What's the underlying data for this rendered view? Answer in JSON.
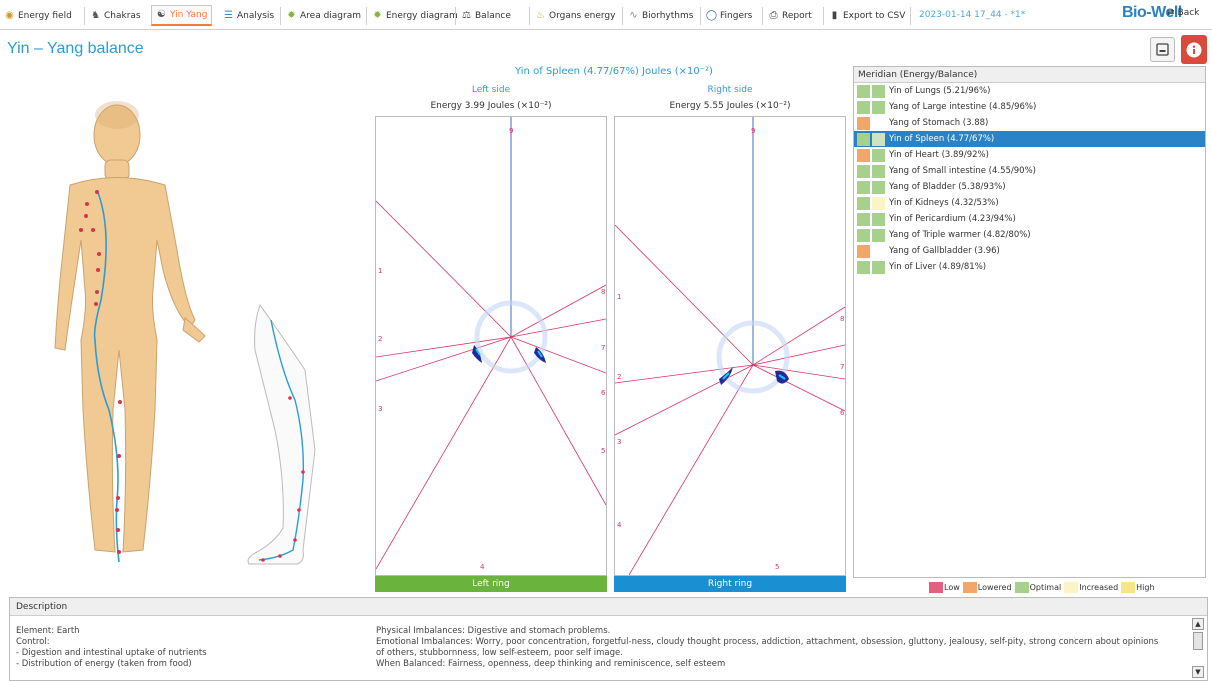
{
  "toolbar": {
    "tabs": [
      {
        "label": "Energy field",
        "icon": "energy-field-icon"
      },
      {
        "label": "Chakras",
        "icon": "chakras-icon"
      },
      {
        "label": "Yin Yang",
        "icon": "yin-yang-icon",
        "active": true
      },
      {
        "label": "Analysis",
        "icon": "analysis-icon"
      },
      {
        "label": "Area diagram",
        "icon": "area-diagram-icon"
      },
      {
        "label": "Energy diagram",
        "icon": "energy-diagram-icon"
      },
      {
        "label": "Balance",
        "icon": "balance-icon"
      },
      {
        "label": "Organs energy",
        "icon": "organs-energy-icon"
      },
      {
        "label": "Biorhythms",
        "icon": "biorhythms-icon"
      },
      {
        "label": "Fingers",
        "icon": "fingers-icon"
      },
      {
        "label": "Report",
        "icon": "printer-icon"
      },
      {
        "label": "Export to CSV",
        "icon": "export-icon"
      }
    ],
    "session": "2023-01-14 17_44 - *1*",
    "logo": "Bio-Well",
    "back_label": "Back"
  },
  "page_title": "Yin – Yang balance",
  "chart": {
    "title": "Yin of Spleen (4.77/67%) Joules (×10⁻²)",
    "left": {
      "side": "Left side",
      "energy": "Energy 3.99 Joules (×10⁻²)",
      "ring": "Left ring",
      "ring_color": "#6ab33c"
    },
    "right": {
      "side": "Right side",
      "energy": "Energy 5.55 Joules (×10⁻²)",
      "ring": "Right ring",
      "ring_color": "#1a8fd1"
    }
  },
  "chart_data": [
    {
      "type": "radial-sector",
      "side": "left",
      "energy": 3.99,
      "sector_labels": [
        "1",
        "2",
        "3",
        "4",
        "5",
        "6",
        "7",
        "8",
        "9"
      ]
    },
    {
      "type": "radial-sector",
      "side": "right",
      "energy": 5.55,
      "sector_labels": [
        "1",
        "2",
        "3",
        "4",
        "5",
        "6",
        "7",
        "8",
        "9"
      ]
    }
  ],
  "meridian": {
    "header": "Meridian (Energy/Balance)",
    "rows": [
      {
        "label": "Yin of Lungs (5.21/96%)",
        "c1": "#a8d08d",
        "c2": "#a8d08d"
      },
      {
        "label": "Yang of Large intestine (4.85/96%)",
        "c1": "#a8d08d",
        "c2": "#a8d08d"
      },
      {
        "label": "Yang of Stomach (3.88)",
        "c1": "#f2a66a",
        "c2": ""
      },
      {
        "label": "Yin of Spleen (4.77/67%)",
        "c1": "#a8d08d",
        "c2": "#a8d08d",
        "selected": true
      },
      {
        "label": "Yin of Heart (3.89/92%)",
        "c1": "#f2a66a",
        "c2": "#a8d08d"
      },
      {
        "label": "Yang of Small intestine (4.55/90%)",
        "c1": "#a8d08d",
        "c2": "#a8d08d"
      },
      {
        "label": "Yang of Bladder (5.38/93%)",
        "c1": "#a8d08d",
        "c2": "#a8d08d"
      },
      {
        "label": "Yin of Kidneys (4.32/53%)",
        "c1": "#a8d08d",
        "c2": "#fdf4c4"
      },
      {
        "label": "Yin of Pericardium (4.23/94%)",
        "c1": "#a8d08d",
        "c2": "#a8d08d"
      },
      {
        "label": "Yang of Triple warmer (4.82/80%)",
        "c1": "#a8d08d",
        "c2": "#a8d08d"
      },
      {
        "label": "Yang of Gallbladder (3.96)",
        "c1": "#f2a66a",
        "c2": ""
      },
      {
        "label": "Yin of Liver (4.89/81%)",
        "c1": "#a8d08d",
        "c2": "#a8d08d"
      }
    ]
  },
  "legend": [
    {
      "label": "Low",
      "color": "#e0607e"
    },
    {
      "label": "Lowered",
      "color": "#f2a66a"
    },
    {
      "label": "Optimal",
      "color": "#a8d08d"
    },
    {
      "label": "Increased",
      "color": "#fdf4c4"
    },
    {
      "label": "High",
      "color": "#f8e48a"
    }
  ],
  "description": {
    "header": "Description",
    "left_lines": [
      "Element: Earth",
      "Control:",
      "- Digestion and intestinal uptake of nutrients",
      "- Distribution of energy (taken from food)"
    ],
    "right_lines": [
      "Physical Imbalances: Digestive and stomach problems.",
      "Emotional Imbalances: Worry, poor concentration, forgetful-ness, cloudy thought process, addiction, attachment, obsession, gluttony, jealousy, self-pity, strong concern about opinions",
      "of others, stubbornness, low self-esteem, poor self image.",
      "When Balanced: Fairness, openness, deep thinking and reminiscence, self esteem"
    ]
  }
}
